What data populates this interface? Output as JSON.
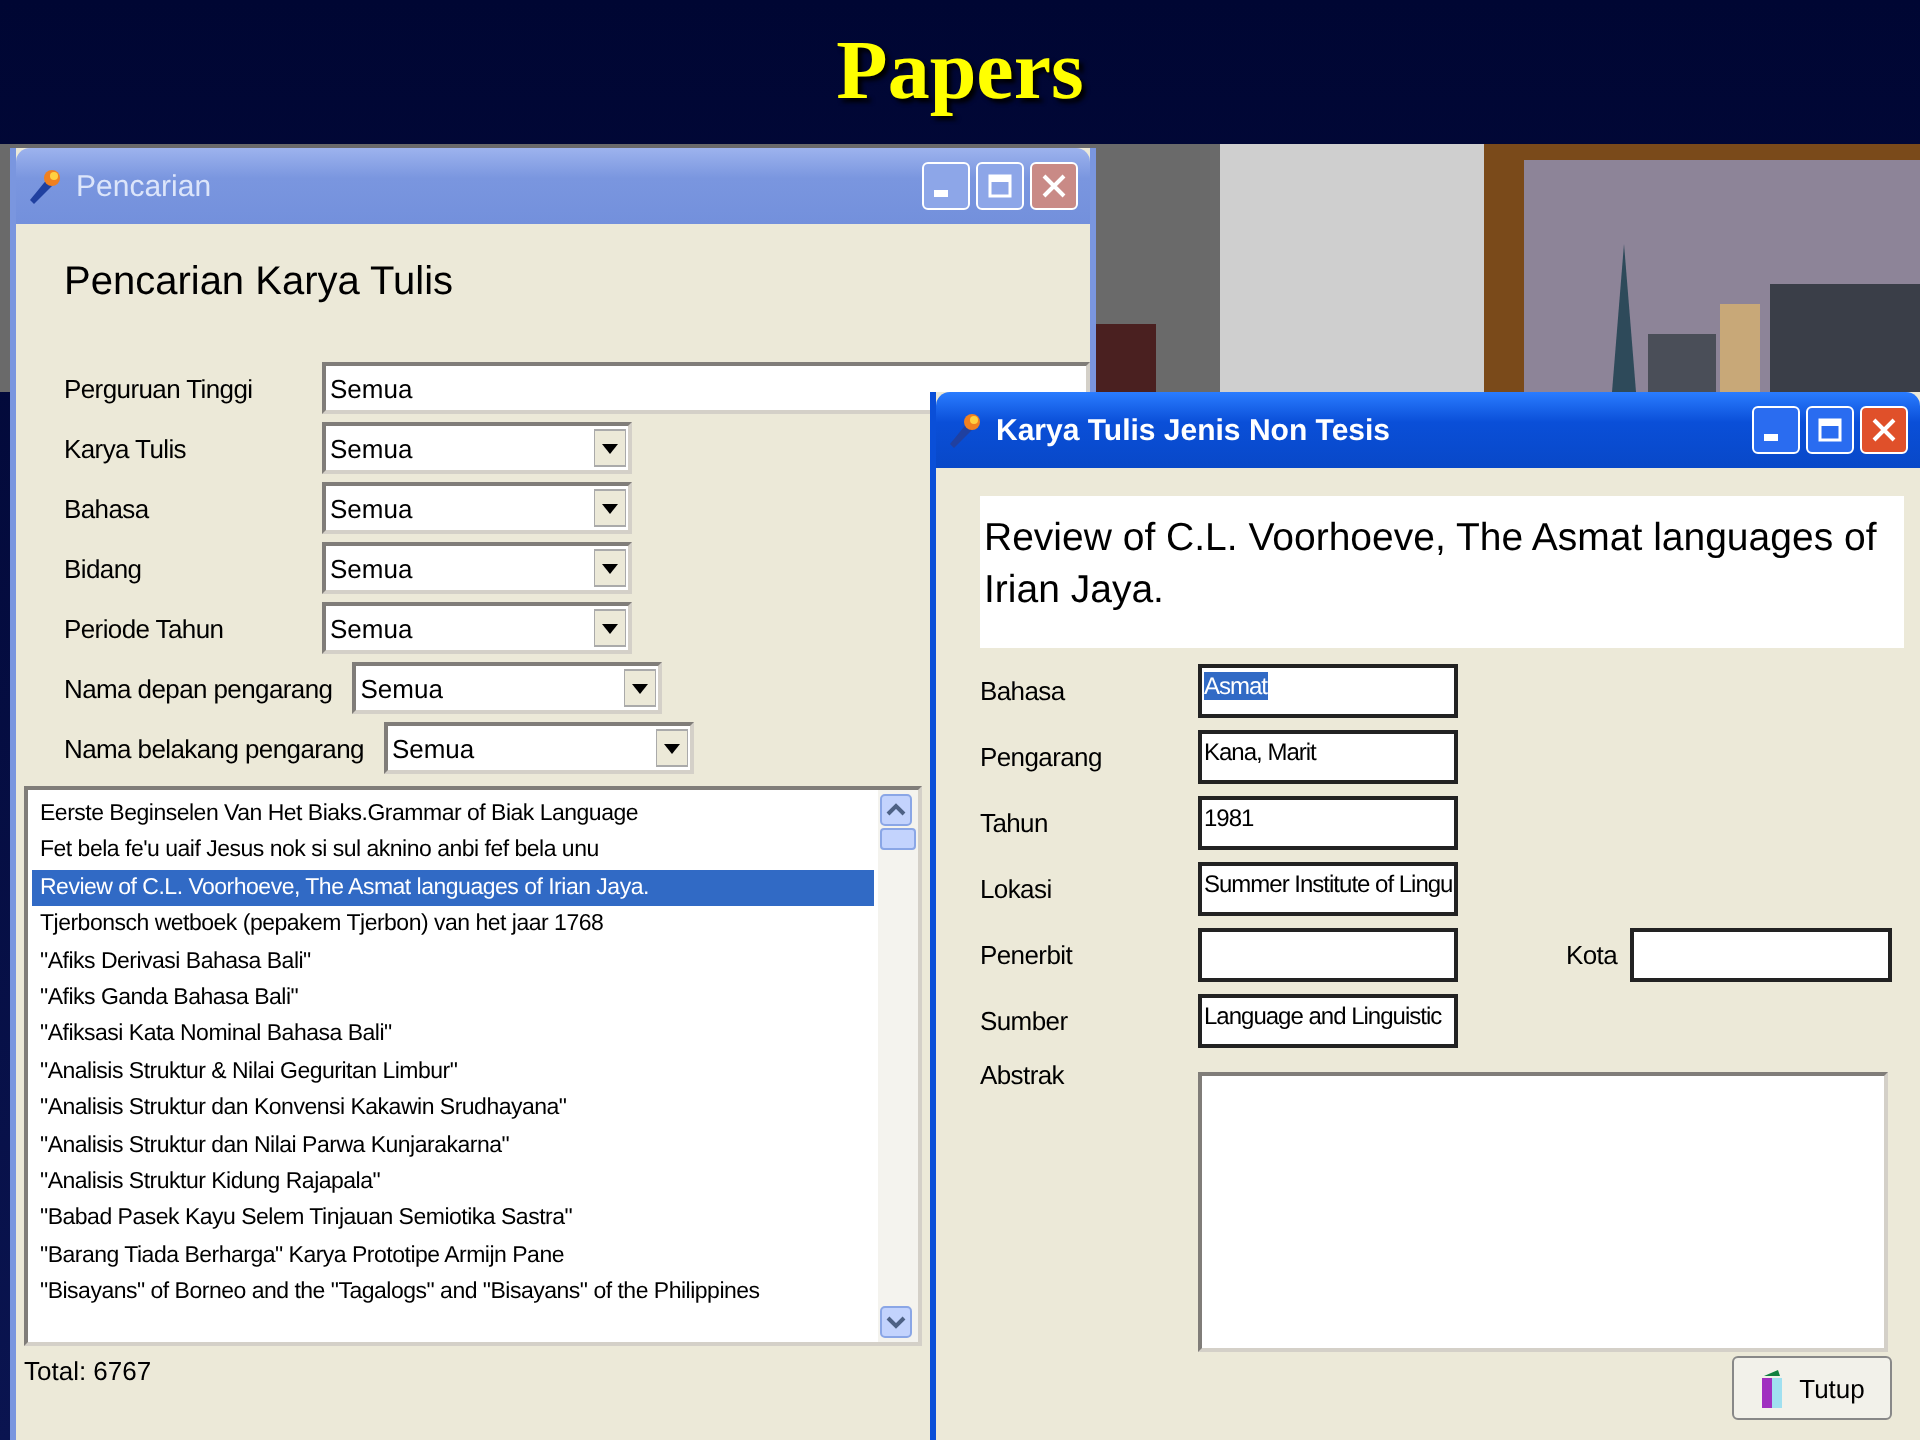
{
  "slide_title": "Papers",
  "search_window": {
    "title": "Pencarian",
    "active": false,
    "heading": "Pencarian Karya Tulis",
    "filters": [
      {
        "label": "Perguruan Tinggi",
        "value": "Semua",
        "kind": "wide"
      },
      {
        "label": "Karya Tulis",
        "value": "Semua",
        "kind": "short"
      },
      {
        "label": "Bahasa",
        "value": "Semua",
        "kind": "short"
      },
      {
        "label": "Bidang",
        "value": "Semua",
        "kind": "short"
      },
      {
        "label": "Periode Tahun",
        "value": "Semua",
        "kind": "short"
      },
      {
        "label": "Nama depan pengarang",
        "value": "Semua",
        "kind": "short"
      },
      {
        "label": "Nama belakang pengarang",
        "value": "Semua",
        "kind": "short"
      }
    ],
    "results": [
      {
        "text": "Eerste Beginselen Van Het Biaks.Grammar of Biak Language",
        "selected": false
      },
      {
        "text": "Fet bela fe'u uaif Jesus nok si sul aknino anbi fef bela unu",
        "selected": false
      },
      {
        "text": "Review of C.L. Voorhoeve, The Asmat languages of Irian Jaya.",
        "selected": true
      },
      {
        "text": "Tjerbonsch wetboek (pepakem Tjerbon) van het jaar 1768",
        "selected": false
      },
      {
        "text": "\"Afiks Derivasi Bahasa Bali\"",
        "selected": false
      },
      {
        "text": "\"Afiks Ganda Bahasa Bali\"",
        "selected": false
      },
      {
        "text": "\"Afiksasi Kata Nominal Bahasa Bali\"",
        "selected": false
      },
      {
        "text": "\"Analisis Struktur & Nilai Geguritan Limbur\"",
        "selected": false
      },
      {
        "text": "\"Analisis Struktur dan Konvensi Kakawin Srudhayana\"",
        "selected": false
      },
      {
        "text": "\"Analisis Struktur dan Nilai Parwa Kunjarakarna\"",
        "selected": false
      },
      {
        "text": "\"Analisis Struktur Kidung Rajapala\"",
        "selected": false
      },
      {
        "text": "\"Babad Pasek Kayu Selem Tinjauan Semiotika Sastra\"",
        "selected": false
      },
      {
        "text": "\"Barang Tiada Berharga\" Karya Prototipe Armijn Pane",
        "selected": false
      },
      {
        "text": "\"Bisayans\" of Borneo and the \"Tagalogs\" and \"Bisayans\" of the Philippines",
        "selected": false
      }
    ],
    "status": "Total: 6767"
  },
  "detail_window": {
    "title": "Karya Tulis Jenis Non Tesis",
    "active": true,
    "heading": "Review of C.L. Voorhoeve, The Asmat languages of Irian Jaya.",
    "fields": [
      {
        "kind": "line",
        "label": "Bahasa",
        "value": "Asmat",
        "highlighted": true
      },
      {
        "kind": "line",
        "label": "Pengarang",
        "value": "Kana, Marit",
        "highlighted": false
      },
      {
        "kind": "line",
        "label": "Tahun",
        "value": "1981",
        "highlighted": false
      },
      {
        "kind": "line",
        "label": "Lokasi",
        "value": "Summer Institute of Lingu",
        "highlighted": false
      },
      {
        "kind": "pair",
        "label": "Penerbit",
        "second_label": "Kota",
        "highlighted": false
      },
      {
        "kind": "line",
        "label": "Sumber",
        "value": "Language and Linguistic",
        "highlighted": false
      },
      {
        "kind": "area",
        "label": "Abstrak",
        "highlighted": false
      }
    ],
    "close_button": "Tutup"
  }
}
